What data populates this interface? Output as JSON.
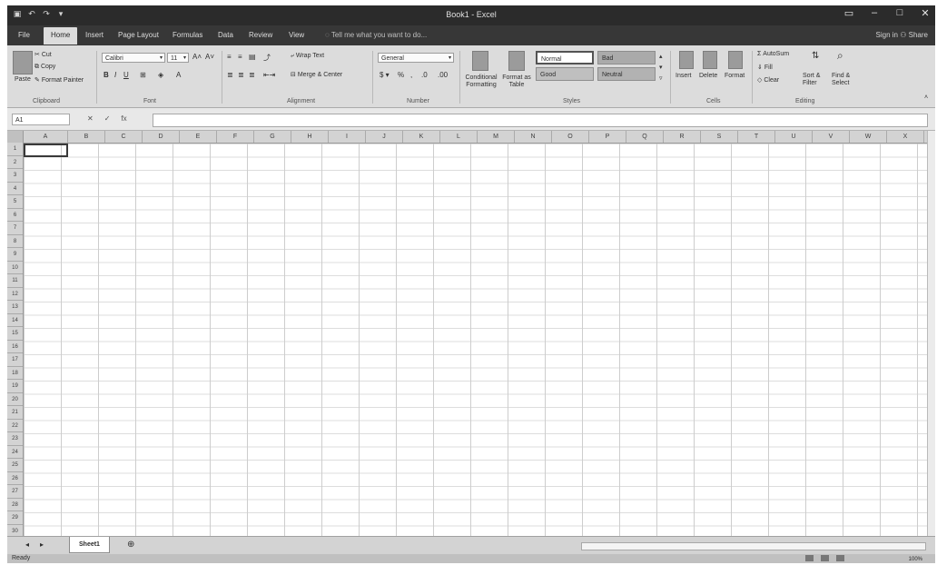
{
  "window": {
    "title": "Book1 - Excel",
    "controls": [
      "restore-icon",
      "minimize-icon",
      "maximize-icon",
      "close-icon"
    ]
  },
  "qat": {
    "items": [
      {
        "name": "save-icon",
        "glyph": "▣"
      },
      {
        "name": "undo-icon",
        "glyph": "↶"
      },
      {
        "name": "redo-icon",
        "glyph": "↷"
      },
      {
        "name": "customize-icon",
        "glyph": "▾"
      }
    ]
  },
  "tabs": [
    {
      "label": "File"
    },
    {
      "label": "Home",
      "active": true
    },
    {
      "label": "Insert"
    },
    {
      "label": "Page Layout"
    },
    {
      "label": "Formulas"
    },
    {
      "label": "Data"
    },
    {
      "label": "Review"
    },
    {
      "label": "View"
    }
  ],
  "tellme": "Tell me what you want to do...",
  "signin": "Sign in",
  "share": "Share",
  "ribbon": {
    "clipboard": {
      "paste": "Paste",
      "cut": "Cut",
      "copy": "Copy",
      "format_painter": "Format Painter",
      "label": "Clipboard"
    },
    "font": {
      "name": "Calibri",
      "size": "11",
      "label": "Font"
    },
    "alignment": {
      "wrap": "Wrap Text",
      "merge": "Merge & Center",
      "label": "Alignment"
    },
    "number": {
      "format": "General",
      "label": "Number"
    },
    "styles": {
      "conditional": "Conditional Formatting",
      "format_table": "Format as Table",
      "normal": "Normal",
      "bad": "Bad",
      "good": "Good",
      "neutral": "Neutral",
      "label": "Styles"
    },
    "cells": {
      "insert": "Insert",
      "delete": "Delete",
      "format": "Format",
      "label": "Cells"
    },
    "editing": {
      "autosum": "AutoSum",
      "fill": "Fill",
      "clear": "Clear",
      "sort": "Sort & Filter",
      "find": "Find & Select",
      "label": "Editing"
    }
  },
  "formula_bar": {
    "namebox": "A1",
    "cancel": "✕",
    "enter": "✓",
    "fx": "fx",
    "value": ""
  },
  "columns": [
    "A",
    "B",
    "C",
    "D",
    "E",
    "F",
    "G",
    "H",
    "I",
    "J",
    "K",
    "L",
    "M",
    "N",
    "O",
    "P",
    "Q",
    "R",
    "S",
    "T",
    "U",
    "V",
    "W",
    "X"
  ],
  "rows": [
    "1",
    "2",
    "3",
    "4",
    "5",
    "6",
    "7",
    "8",
    "9",
    "10",
    "11",
    "12",
    "13",
    "14",
    "15",
    "16",
    "17",
    "18",
    "19",
    "20",
    "21",
    "22",
    "23",
    "24",
    "25",
    "26",
    "27",
    "28",
    "29",
    "30"
  ],
  "sheets": [
    {
      "label": "Sheet1",
      "active": true
    }
  ],
  "status": {
    "text": "Ready",
    "zoom": "100%"
  }
}
